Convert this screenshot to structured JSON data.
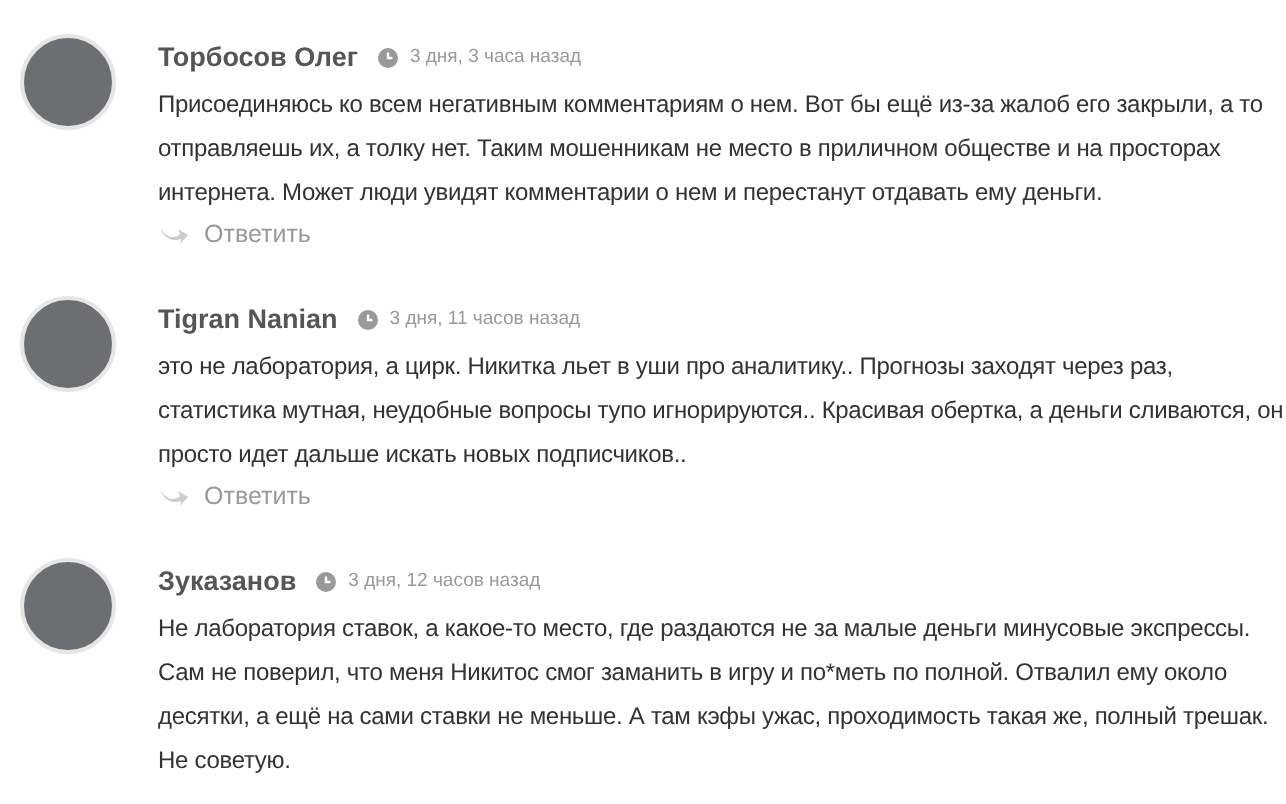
{
  "comments": [
    {
      "author": "Торбосов Олег",
      "time": "3 дня, 3 часа назад",
      "text": "Присоединяюсь ко всем негативным комментариям о нем. Вот бы ещё из-за жалоб его закрыли, а то отправляешь их, а толку нет. Таким мошенникам не место в приличном обществе и на просторах интернета. Может люди увидят комментарии о нем и перестанут отдавать ему деньги.",
      "reply": "Ответить"
    },
    {
      "author": "Tigran Nanian",
      "time": "3 дня, 11 часов назад",
      "text": "это не лаборатория, а цирк. Никитка льет в уши про аналитику.. Прогнозы заходят через раз, статистика мутная, неудобные вопросы тупо игнорируются.. Красивая обертка, а деньги сливаются, он просто идет дальше искать новых подписчиков..",
      "reply": "Ответить"
    },
    {
      "author": "Зуказанов",
      "time": "3 дня, 12 часов назад",
      "text": "Не лаборатория ставок, а какое-то место, где раздаются не за малые деньги минусовые экспрессы. Сам не поверил, что меня Никитос смог заманить в игру и по*меть по полной. Отвалил ему около десятки, а ещё на сами ставки не меньше. А там кэфы ужас, проходимость такая же, полный трешак. Не советую."
    }
  ]
}
